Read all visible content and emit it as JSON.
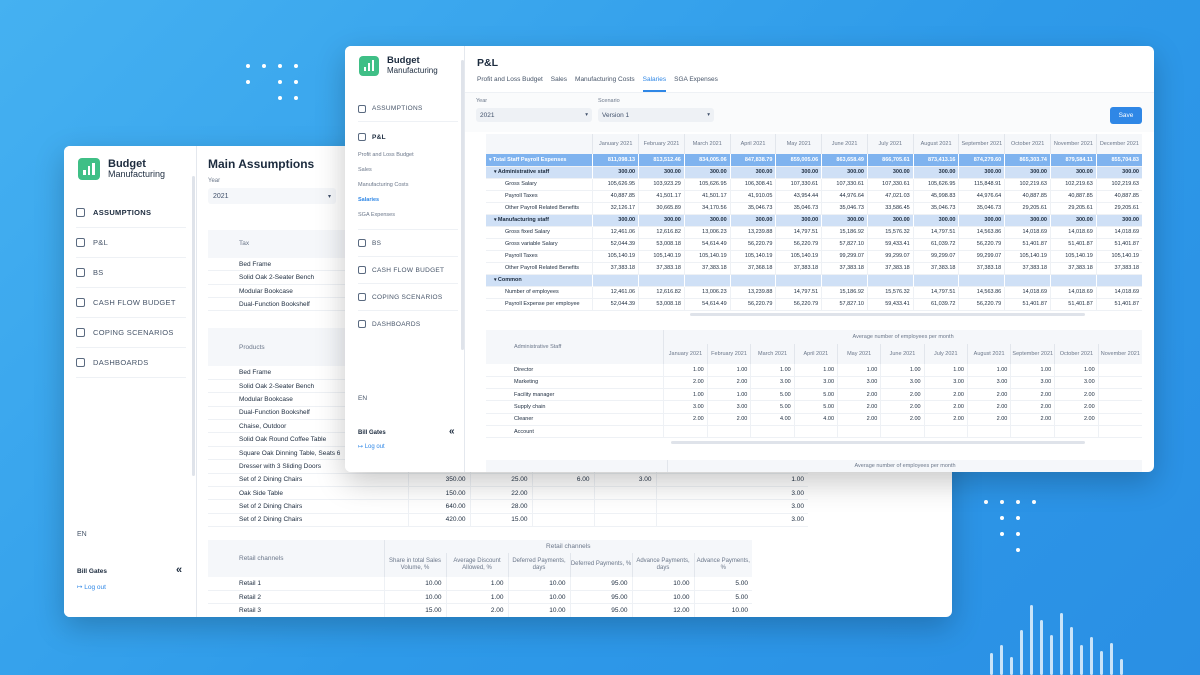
{
  "back": {
    "brand": {
      "name": "Budget",
      "sub": "Manufacturing"
    },
    "title": "Main Assumptions",
    "year_label": "Year",
    "year_value": "2021",
    "nav": [
      "ASSUMPTIONS",
      "P&L",
      "BS",
      "CASH FLOW BUDGET",
      "COPING SCENARIOS",
      "DASHBOARDS"
    ],
    "lang": "EN",
    "user": "Bill Gates",
    "logout": "Log out",
    "tax_header": "Tax",
    "tax_rows": [
      "Bed Frame",
      "Solid Oak 2-Seater Bench",
      "Modular Bookcase",
      "Dual-Function Bookshelf"
    ],
    "products_header": "Products",
    "products": [
      {
        "name": "Bed Frame",
        "v": [
          "",
          "",
          "",
          "",
          ""
        ]
      },
      {
        "name": "Solid Oak 2-Seater Bench",
        "v": [
          "",
          "",
          "",
          "",
          ""
        ]
      },
      {
        "name": "Modular Bookcase",
        "v": [
          "",
          "",
          "",
          "",
          ""
        ]
      },
      {
        "name": "Dual-Function Bookshelf",
        "v": [
          "",
          "",
          "",
          "",
          ""
        ]
      },
      {
        "name": "Chaise, Outdoor",
        "v": [
          "",
          "",
          "",
          "",
          ""
        ]
      },
      {
        "name": "Solid Oak Round Coffee Table",
        "v": [
          "",
          "",
          "",
          "",
          ""
        ]
      },
      {
        "name": "Square Oak Dinning Table, Seats 6",
        "v": [
          "",
          "",
          "",
          "",
          ""
        ]
      },
      {
        "name": "Dresser with 3 Sliding Doors",
        "v": [
          "",
          "",
          "",
          "",
          ""
        ]
      },
      {
        "name": "Set of 2 Dining Chairs",
        "v": [
          "350.00",
          "25.00",
          "6.00",
          "3.00",
          "1.00"
        ]
      },
      {
        "name": "Oak Side Table",
        "v": [
          "150.00",
          "22.00",
          "",
          "",
          "3.00"
        ]
      },
      {
        "name": "Set of 2 Dining Chairs",
        "v": [
          "640.00",
          "28.00",
          "",
          "",
          "3.00"
        ]
      },
      {
        "name": "Set of 2 Dining Chairs",
        "v": [
          "420.00",
          "15.00",
          "",
          "",
          "3.00"
        ]
      }
    ],
    "retail": {
      "row_header": "Retail channels",
      "group_header": "Retail channels",
      "columns": [
        "Share in total Sales Volume, %",
        "Average Discount Allowed, %",
        "Deferred Payments, days",
        "Deferred Payments, %",
        "Advance Payments, days",
        "Advance Payments, %"
      ],
      "rows": [
        {
          "name": "Retail 1",
          "v": [
            "10.00",
            "1.00",
            "10.00",
            "95.00",
            "10.00",
            "5.00"
          ]
        },
        {
          "name": "Retail 2",
          "v": [
            "10.00",
            "1.00",
            "10.00",
            "95.00",
            "10.00",
            "5.00"
          ]
        },
        {
          "name": "Retail 3",
          "v": [
            "15.00",
            "2.00",
            "10.00",
            "95.00",
            "12.00",
            "10.00"
          ]
        }
      ]
    }
  },
  "front": {
    "brand": {
      "name": "Budget",
      "sub": "Manufacturing"
    },
    "title": "P&L",
    "tabs": [
      "Profit and Loss Budget",
      "Sales",
      "Manufacturing Costs",
      "Salaries",
      "SGA Expenses"
    ],
    "active_tab": 3,
    "nav_assumptions": "ASSUMPTIONS",
    "nav_pl": "P&L",
    "sub_nav": [
      "Profit and Loss Budget",
      "Sales",
      "Manufacturing Costs",
      "Salaries",
      "SGA Expenses"
    ],
    "active_sub": 3,
    "nav_rest": [
      "BS",
      "CASH FLOW BUDGET",
      "COPING SCENARIOS",
      "DASHBOARDS"
    ],
    "lang": "EN",
    "user": "Bill Gates",
    "logout": "Log out",
    "year_label": "Year",
    "year_value": "2021",
    "scenario_label": "Scenario",
    "scenario_value": "Version 1",
    "save": "Save",
    "months": [
      "January 2021",
      "February 2021",
      "March 2021",
      "April 2021",
      "May 2021",
      "June 2021",
      "July 2021",
      "August 2021",
      "September 2021",
      "October 2021",
      "November 2021",
      "December 2021"
    ],
    "payroll": [
      {
        "label": "Total Staff Payroll Expenses",
        "kind": "total",
        "v": [
          "811,098.13",
          "813,512.46",
          "834,005.06",
          "847,838.79",
          "859,005.06",
          "863,658.49",
          "866,705.61",
          "873,413.16",
          "874,279.60",
          "865,303.74",
          "879,584.11",
          "855,704.83"
        ]
      },
      {
        "label": "Administrative staff",
        "kind": "group",
        "v": [
          "300.00",
          "300.00",
          "300.00",
          "300.00",
          "300.00",
          "300.00",
          "300.00",
          "300.00",
          "300.00",
          "300.00",
          "300.00",
          "300.00"
        ]
      },
      {
        "label": "Gross Salary",
        "kind": "row",
        "v": [
          "105,626.95",
          "103,923.29",
          "105,626.95",
          "106,308.41",
          "107,330.61",
          "107,330.61",
          "107,330.61",
          "105,626.95",
          "115,848.91",
          "102,219.63",
          "102,219.63",
          "102,219.63"
        ]
      },
      {
        "label": "Payroll Taxes",
        "kind": "row",
        "v": [
          "40,887.85",
          "41,501.17",
          "41,501.17",
          "41,910.05",
          "43,954.44",
          "44,976.64",
          "47,021.03",
          "45,998.83",
          "44,976.64",
          "40,887.85",
          "40,887.85",
          "40,887.85"
        ]
      },
      {
        "label": "Other Payroll Related Benefits",
        "kind": "row",
        "v": [
          "32,126.17",
          "30,665.89",
          "34,170.56",
          "35,046.73",
          "35,046.73",
          "35,046.73",
          "33,586.45",
          "35,046.73",
          "35,046.73",
          "29,205.61",
          "29,205.61",
          "29,205.61"
        ]
      },
      {
        "label": "Manufacturing staff",
        "kind": "group",
        "v": [
          "300.00",
          "300.00",
          "300.00",
          "300.00",
          "300.00",
          "300.00",
          "300.00",
          "300.00",
          "300.00",
          "300.00",
          "300.00",
          "300.00"
        ]
      },
      {
        "label": "Gross fixed Salary",
        "kind": "row",
        "v": [
          "12,461.06",
          "12,616.82",
          "13,006.23",
          "13,239.88",
          "14,797.51",
          "15,186.92",
          "15,576.32",
          "14,797.51",
          "14,563.86",
          "14,018.69",
          "14,018.69",
          "14,018.69"
        ]
      },
      {
        "label": "Gross variable Salary",
        "kind": "row",
        "v": [
          "52,044.39",
          "53,008.18",
          "54,614.49",
          "56,220.79",
          "56,220.79",
          "57,827.10",
          "59,433.41",
          "61,039.72",
          "56,220.79",
          "51,401.87",
          "51,401.87",
          "51,401.87"
        ]
      },
      {
        "label": "Payroll Taxes",
        "kind": "row",
        "v": [
          "105,140.19",
          "105,140.19",
          "105,140.19",
          "105,140.19",
          "105,140.19",
          "99,299.07",
          "99,299.07",
          "99,299.07",
          "99,299.07",
          "105,140.19",
          "105,140.19",
          "105,140.19"
        ]
      },
      {
        "label": "Other Payroll Related Benefits",
        "kind": "row",
        "v": [
          "37,383.18",
          "37,383.18",
          "37,383.18",
          "37,368.18",
          "37,383.18",
          "37,383.18",
          "37,383.18",
          "37,383.18",
          "37,383.18",
          "37,383.18",
          "37,383.18",
          "37,383.18"
        ]
      },
      {
        "label": "Common",
        "kind": "group",
        "v": [
          "",
          "",
          "",
          "",
          "",
          "",
          "",
          "",
          "",
          "",
          "",
          ""
        ]
      },
      {
        "label": "Number of employees",
        "kind": "row",
        "v": [
          "12,461.06",
          "12,616.82",
          "13,006.23",
          "13,239.88",
          "14,797.51",
          "15,186.92",
          "15,576.32",
          "14,797.51",
          "14,563.86",
          "14,018.69",
          "14,018.69",
          "14,018.69"
        ]
      },
      {
        "label": "Payroll Expense per employee",
        "kind": "row",
        "v": [
          "52,044.39",
          "53,008.18",
          "54,614.49",
          "56,220.79",
          "56,220.79",
          "57,827.10",
          "59,433.41",
          "61,039.72",
          "56,220.79",
          "51,401.87",
          "51,401.87",
          "51,401.87"
        ]
      }
    ],
    "emp": {
      "row_header": "Administrative Staff",
      "group_header": "Average number of employees per month",
      "months": [
        "January 2021",
        "February 2021",
        "March 2021",
        "April 2021",
        "May 2021",
        "June 2021",
        "July 2021",
        "August 2021",
        "September 2021",
        "October 2021",
        "November 2021"
      ],
      "rows": [
        {
          "label": "Director",
          "v": [
            "1.00",
            "1.00",
            "1.00",
            "1.00",
            "1.00",
            "1.00",
            "1.00",
            "1.00",
            "1.00",
            "1.00",
            ""
          ]
        },
        {
          "label": "Marketing",
          "v": [
            "2.00",
            "2.00",
            "3.00",
            "3.00",
            "3.00",
            "3.00",
            "3.00",
            "3.00",
            "3.00",
            "3.00",
            ""
          ]
        },
        {
          "label": "Facility manager",
          "v": [
            "1.00",
            "1.00",
            "5.00",
            "5.00",
            "2.00",
            "2.00",
            "2.00",
            "2.00",
            "2.00",
            "2.00",
            ""
          ]
        },
        {
          "label": "Supply chain",
          "v": [
            "3.00",
            "3.00",
            "5.00",
            "5.00",
            "2.00",
            "2.00",
            "2.00",
            "2.00",
            "2.00",
            "2.00",
            ""
          ]
        },
        {
          "label": "Cleaner",
          "v": [
            "2.00",
            "2.00",
            "4.00",
            "4.00",
            "2.00",
            "2.00",
            "2.00",
            "2.00",
            "2.00",
            "2.00",
            ""
          ]
        },
        {
          "label": "Account",
          "v": [
            "",
            "",
            "",
            "",
            "",
            "",
            "",
            "",
            "",
            "",
            ""
          ]
        }
      ],
      "footer_header": "Average number of employees per month"
    }
  },
  "colors": {
    "accent": "#2f87e6",
    "total_row": "#7fb3ef",
    "group_row": "#cfe0f6",
    "brand": "#3fbf86"
  }
}
